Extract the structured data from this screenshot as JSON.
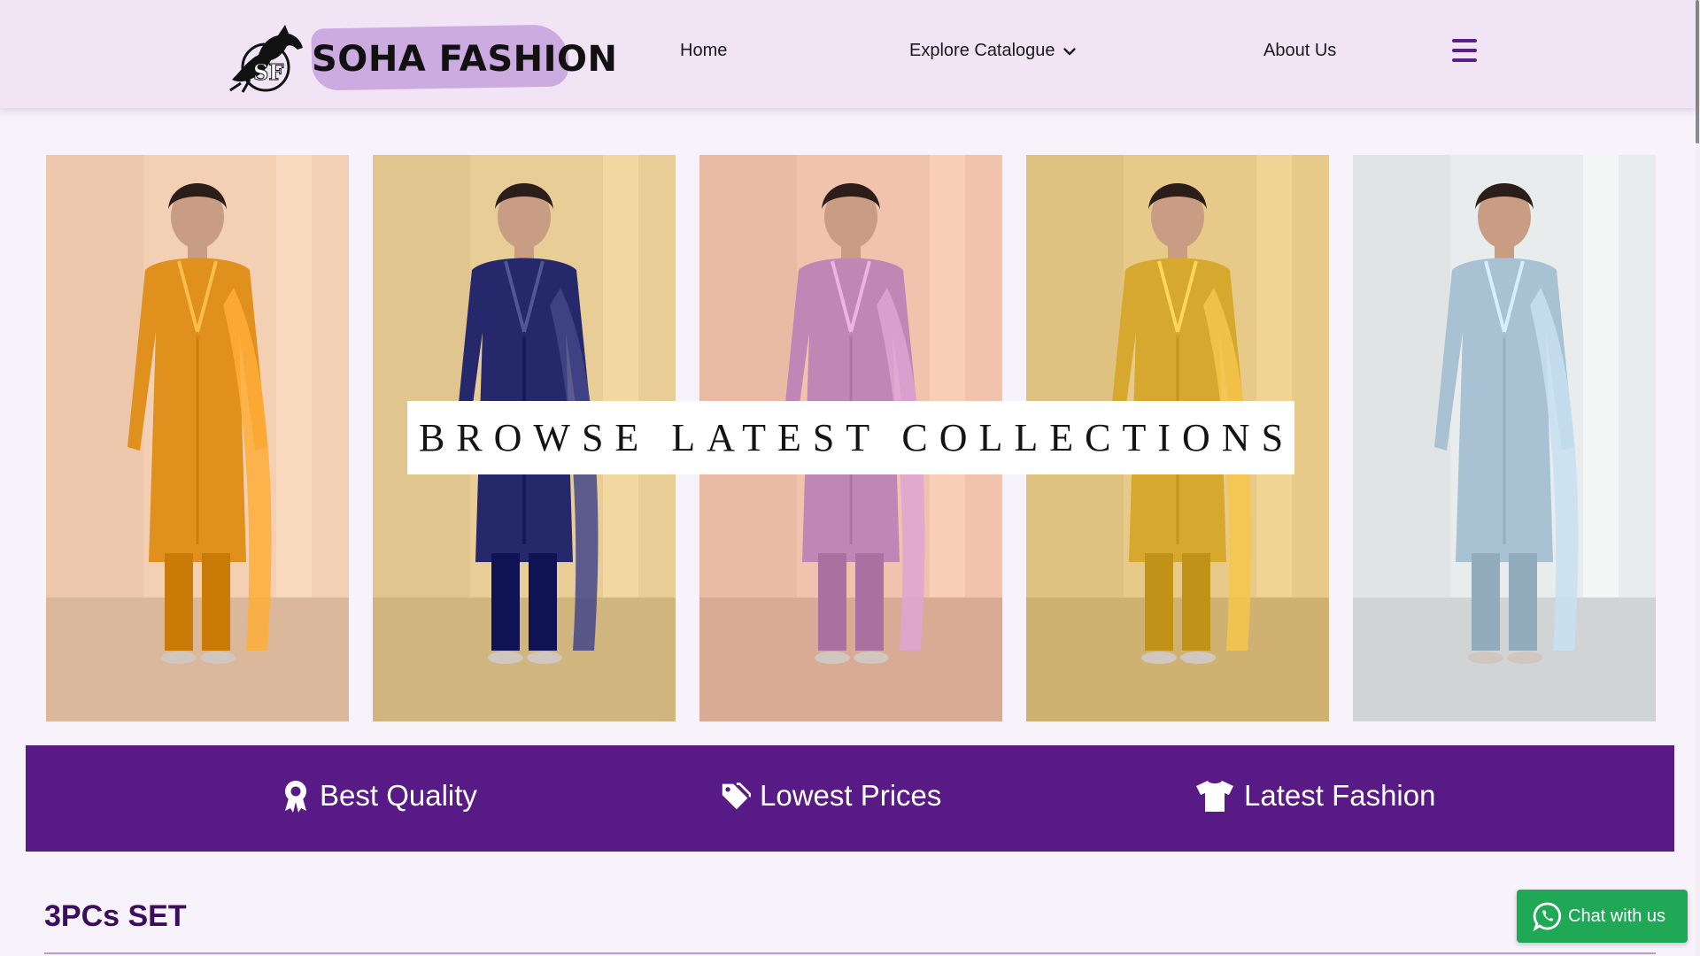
{
  "brand": {
    "name": "SOHA FASHION",
    "monogram": "SF",
    "logo_icon": "horse-monogram-logo"
  },
  "nav": {
    "home": "Home",
    "explore": "Explore Catalogue",
    "about": "About Us",
    "menu_icon": "hamburger-menu-icon"
  },
  "hero": {
    "banner": "BROWSE LATEST COLLECTIONS",
    "panels": [
      {
        "outfit_color": "#e0901c",
        "bg_color": "#f3cfb4"
      },
      {
        "outfit_color": "#25286b",
        "bg_color": "#e8cd97"
      },
      {
        "outfit_color": "#bf87b6",
        "bg_color": "#f1c3ac"
      },
      {
        "outfit_color": "#d6a82d",
        "bg_color": "#e7c98a"
      },
      {
        "outfit_color": "#a9c2d3",
        "bg_color": "#e9ecec"
      }
    ]
  },
  "features": [
    {
      "label": "Best Quality",
      "icon": "award-badge-icon"
    },
    {
      "label": "Lowest Prices",
      "icon": "price-tags-icon"
    },
    {
      "label": "Latest Fashion",
      "icon": "tshirt-icon"
    }
  ],
  "section": {
    "title": "3PCs SET"
  },
  "chat": {
    "label": "Chat with us",
    "icon": "whatsapp-icon"
  },
  "colors": {
    "accent_purple": "#581b86",
    "header_bg": "#f1e5f5",
    "chat_green": "#1fa855"
  }
}
